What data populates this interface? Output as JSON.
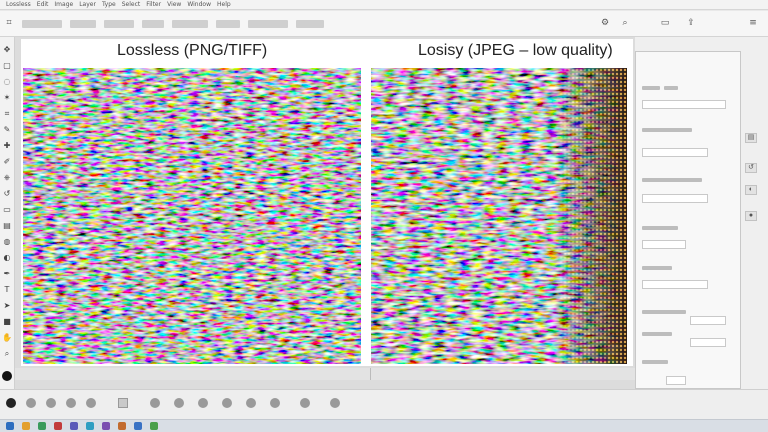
{
  "menubar": {
    "items": [
      "Lossless",
      "Edit",
      "Image",
      "Layer",
      "Type",
      "Select",
      "Filter",
      "View",
      "Window",
      "Help"
    ]
  },
  "options": {
    "mode_icon": "crop-icon"
  },
  "tools": [
    "move-icon",
    "marquee-icon",
    "lasso-icon",
    "wand-icon",
    "crop-icon",
    "eyedropper-icon",
    "heal-icon",
    "brush-icon",
    "stamp-icon",
    "history-icon",
    "eraser-icon",
    "gradient-icon",
    "blur-icon",
    "dodge-icon",
    "pen-icon",
    "text-icon",
    "path-icon",
    "shape-icon",
    "hand-icon",
    "zoom-icon"
  ],
  "canvas": {
    "left_title": "Lossless (PNG/TIFF)",
    "right_title": "Losisy (JPEG – low quality)",
    "left_status": "",
    "right_status": ""
  },
  "colors": {
    "accent": "#3a72c4",
    "panel_bg": "#f8f8f8"
  },
  "taskbar": {
    "clock": ""
  }
}
